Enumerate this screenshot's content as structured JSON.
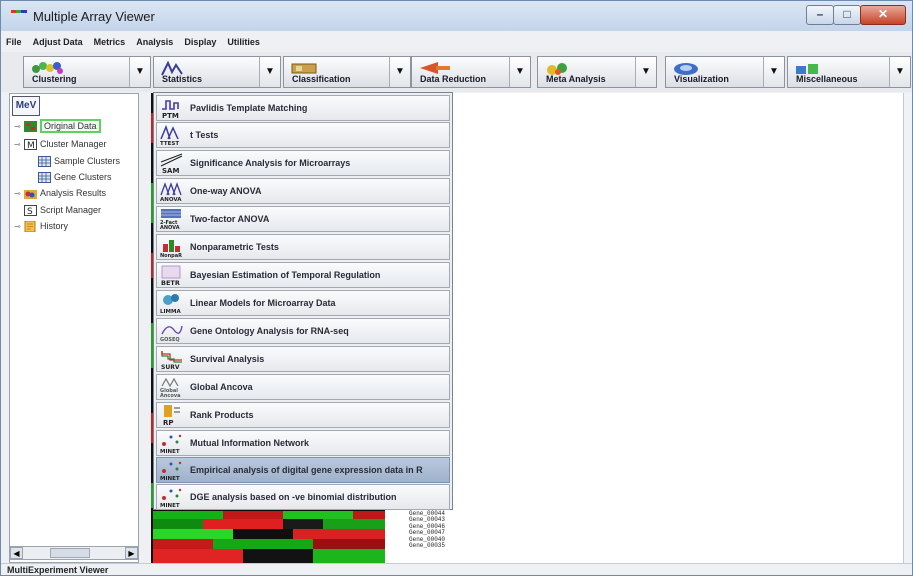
{
  "window": {
    "title": "Multiple Array Viewer"
  },
  "menubar": [
    "File",
    "Adjust Data",
    "Metrics",
    "Analysis",
    "Display",
    "Utilities"
  ],
  "toolbar": [
    {
      "label": "Clustering",
      "icon": "clustering-icon"
    },
    {
      "label": "Statistics",
      "icon": "statistics-icon"
    },
    {
      "label": "Classification",
      "icon": "classification-icon"
    },
    {
      "label": "Data Reduction",
      "icon": "data-reduction-icon"
    },
    {
      "label": "Meta Analysis",
      "icon": "meta-analysis-icon"
    },
    {
      "label": "Visualization",
      "icon": "visualization-icon"
    },
    {
      "label": "Miscellaneous",
      "icon": "miscellaneous-icon"
    }
  ],
  "tree": {
    "logo": "MeV",
    "items": [
      {
        "label": "Original Data",
        "icon": "data-icon",
        "selected": true
      },
      {
        "label": "Cluster Manager",
        "icon": "cluster-manager-icon"
      },
      {
        "label": "Sample Clusters",
        "icon": "table-icon"
      },
      {
        "label": "Gene Clusters",
        "icon": "table-icon"
      },
      {
        "label": "Analysis Results",
        "icon": "folder-icon"
      },
      {
        "label": "Script Manager",
        "icon": "script-icon"
      },
      {
        "label": "History",
        "icon": "history-icon"
      }
    ]
  },
  "statistics_menu": [
    {
      "label": "Pavlidis Template Matching",
      "tag": "PTM"
    },
    {
      "label": "t Tests",
      "tag": "TTEST"
    },
    {
      "label": "Significance Analysis for Microarrays",
      "tag": "SAM"
    },
    {
      "label": "One-way ANOVA",
      "tag": "ANOVA"
    },
    {
      "label": "Two-factor ANOVA",
      "tag": "2-Fact ANOVA"
    },
    {
      "label": "Nonparametric Tests",
      "tag": "NonpaR"
    },
    {
      "label": "Bayesian Estimation of Temporal Regulation",
      "tag": "BETR"
    },
    {
      "label": "Linear Models for Microarray Data",
      "tag": "LIMMA"
    },
    {
      "label": "Gene Ontology Analysis for RNA-seq",
      "tag": "GOSEQ"
    },
    {
      "label": "Survival Analysis",
      "tag": "SURV"
    },
    {
      "label": "Global Ancova",
      "tag": "Global Ancova"
    },
    {
      "label": "Rank Products",
      "tag": "RP"
    },
    {
      "label": "Mutual Information Network",
      "tag": "MINET"
    },
    {
      "label": "Empirical analysis of digital gene expression data in R",
      "tag": "MINET",
      "highlighted": true
    },
    {
      "label": "DGE analysis based on -ve binomial distribution",
      "tag": "MINET"
    }
  ],
  "gene_labels": [
    "Gene_00044",
    "Gene_00043",
    "Gene_00046",
    "Gene_00047",
    "Gene_00040",
    "Gene_00035"
  ],
  "status": {
    "text": "MultiExperiment Viewer"
  }
}
